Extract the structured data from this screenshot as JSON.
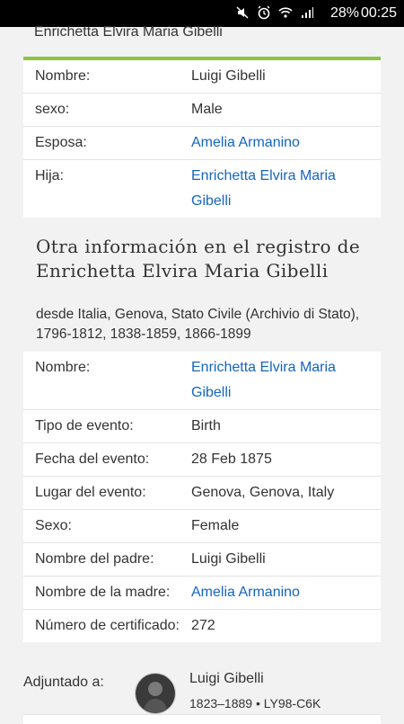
{
  "status_bar": {
    "battery_percent": "28%",
    "time": "00:25",
    "icons": [
      "mute-icon",
      "alarm-icon",
      "wifi-icon",
      "signal-icon",
      "battery-icon"
    ]
  },
  "page": {
    "top_title": "Enrichetta Elvira Maria Gibelli"
  },
  "card1": {
    "rows": [
      {
        "label": "Nombre:",
        "value": "Luigi Gibelli",
        "link": false
      },
      {
        "label": "sexo:",
        "value": "Male",
        "link": false
      },
      {
        "label": "Esposa:",
        "value": "Amelia Armanino",
        "link": true
      },
      {
        "label": "Hija:",
        "value": "Enrichetta Elvira Maria Gibelli",
        "link": true
      }
    ]
  },
  "section2": {
    "heading": "Otra información en el registro de Enrichetta Elvira Maria Gibelli",
    "subheading": "desde Italia, Genova, Stato Civile (Archivio di Stato), 1796-1812, 1838-1859, 1866-1899",
    "rows": [
      {
        "label": "Nombre:",
        "value": "Enrichetta Elvira Maria Gibelli",
        "link": true
      },
      {
        "label": "Tipo de evento:",
        "value": "Birth",
        "link": false
      },
      {
        "label": "Fecha del evento:",
        "value": "28 Feb 1875",
        "link": false
      },
      {
        "label": "Lugar del evento:",
        "value": "Genova, Genova, Italy",
        "link": false
      },
      {
        "label": "Sexo:",
        "value": "Female",
        "link": false
      },
      {
        "label": "Nombre del padre:",
        "value": "Luigi Gibelli",
        "link": false
      },
      {
        "label": "Nombre de la madre:",
        "value": "Amelia Armanino",
        "link": true
      },
      {
        "label": "Número de certificado:",
        "value": "272",
        "link": false
      }
    ]
  },
  "attached": {
    "label": "Adjuntado a:",
    "name": "Luigi Gibelli",
    "meta": "1823–1889 • LY98-C6K"
  },
  "colors": {
    "accent_green": "#8cc63f",
    "link_blue": "#1565c0"
  }
}
